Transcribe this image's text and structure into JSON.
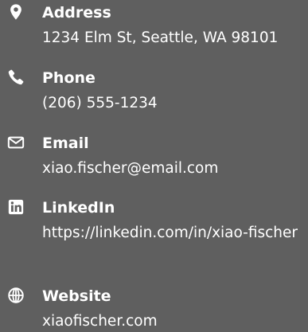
{
  "contacts": {
    "address": {
      "label": "Address",
      "value": "1234 Elm St, Seattle, WA 98101",
      "icon": "map-pin-icon"
    },
    "phone": {
      "label": "Phone",
      "value": "(206) 555-1234",
      "icon": "phone-icon"
    },
    "email": {
      "label": "Email",
      "value": "xiao.fischer@email.com",
      "icon": "envelope-icon"
    },
    "linkedin": {
      "label": "LinkedIn",
      "value": "https://linkedin.com/in/xiao-fischer",
      "icon": "linkedin-icon"
    },
    "website": {
      "label": "Website",
      "value": "xiaofischer.com",
      "icon": "globe-icon"
    }
  },
  "colors": {
    "background": "#5f5f5f",
    "text": "#ffffff"
  }
}
